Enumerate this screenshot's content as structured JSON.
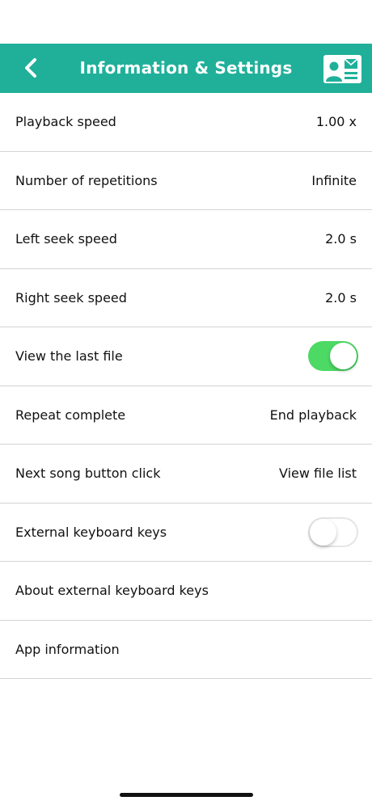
{
  "header": {
    "title": "Information & Settings",
    "back_icon": "chevron-left-icon",
    "contact_icon": "contact-card-mail-icon",
    "background_color": "#20b09a"
  },
  "settings": [
    {
      "label": "Playback speed",
      "value": "1.00 x"
    },
    {
      "label": "Number of repetitions",
      "value": "Infinite"
    },
    {
      "label": "Left seek speed",
      "value": "2.0 s"
    },
    {
      "label": "Right seek speed",
      "value": "2.0 s"
    },
    {
      "label": "View the last file",
      "toggle": true
    },
    {
      "label": "Repeat complete",
      "value": "End playback"
    },
    {
      "label": "Next song button click",
      "value": "View file list"
    },
    {
      "label": "External keyboard keys",
      "toggle": false
    },
    {
      "label": "About external keyboard keys"
    },
    {
      "label": "App information"
    }
  ],
  "colors": {
    "toggle_on": "#4cd964",
    "separator": "#d4d4d4"
  }
}
